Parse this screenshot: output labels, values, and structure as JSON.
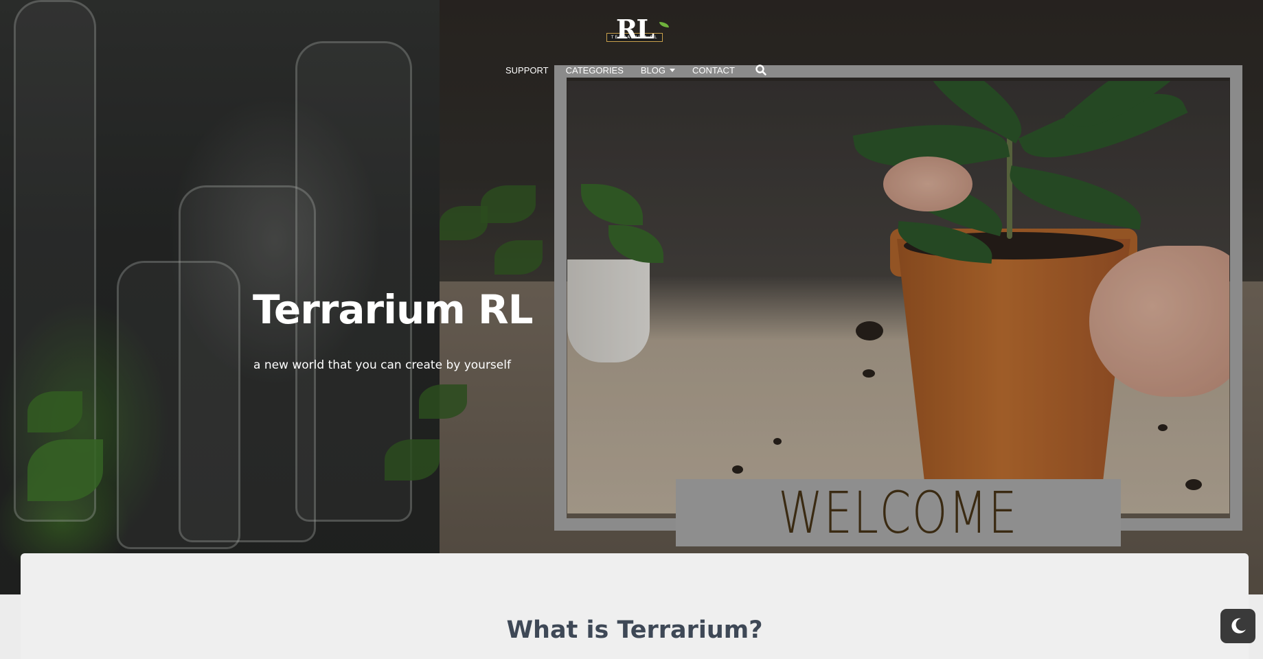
{
  "logo": {
    "monogram": "RL",
    "band_text": "TERRARIUM RL"
  },
  "nav": {
    "items": [
      {
        "label": "SUPPORT"
      },
      {
        "label": "CATEGORIES"
      },
      {
        "label": "BLOG",
        "has_dropdown": true
      },
      {
        "label": "CONTACT"
      }
    ],
    "search_icon": "search-icon"
  },
  "hero": {
    "title": "Terrarium RL",
    "subtitle": "a new world that you can create by yourself",
    "image_sign": "WELCOME"
  },
  "content": {
    "heading": "What is Terrarium?"
  },
  "dark_mode_toggle": {
    "icon": "moon-icon"
  },
  "colors": {
    "heading": "#3e4856",
    "logo_band_border": "#c9a04b",
    "logo_leaf": "#6fb23c",
    "frame": "#8b8b8b",
    "toggle_bg": "#3a3a3a"
  }
}
